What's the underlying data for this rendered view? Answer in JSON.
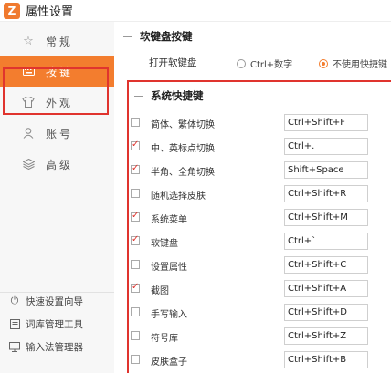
{
  "window": {
    "title": "属性设置",
    "logo_glyph": "Z"
  },
  "sidebar": {
    "items": [
      {
        "label": "常规",
        "icon": "star-icon"
      },
      {
        "label": "按键",
        "icon": "keyboard-icon",
        "active": true
      },
      {
        "label": "外观",
        "icon": "shirt-icon"
      },
      {
        "label": "账号",
        "icon": "user-icon"
      },
      {
        "label": "高级",
        "icon": "layers-icon"
      }
    ],
    "tools": [
      {
        "label": "快速设置向导",
        "icon": "power-icon"
      },
      {
        "label": "词库管理工具",
        "icon": "dictionary-icon"
      },
      {
        "label": "输入法管理器",
        "icon": "monitor-icon"
      }
    ]
  },
  "soft_keyboard": {
    "section_title": "软键盘按键",
    "open_label": "打开软键盘",
    "options": [
      {
        "label": "Ctrl+数字",
        "selected": false
      },
      {
        "label": "不使用快捷键",
        "selected": true
      }
    ]
  },
  "system_shortcuts": {
    "section_title": "系统快捷键",
    "rows": [
      {
        "label": "简体、繁体切换",
        "checked": false,
        "value": "Ctrl+Shift+F"
      },
      {
        "label": "中、英标点切换",
        "checked": true,
        "value": "Ctrl+."
      },
      {
        "label": "半角、全角切换",
        "checked": true,
        "value": "Shift+Space"
      },
      {
        "label": "随机选择皮肤",
        "checked": false,
        "value": "Ctrl+Shift+R"
      },
      {
        "label": "系统菜单",
        "checked": true,
        "value": "Ctrl+Shift+M"
      },
      {
        "label": "软键盘",
        "checked": true,
        "value": "Ctrl+`"
      },
      {
        "label": "设置属性",
        "checked": false,
        "value": "Ctrl+Shift+C"
      },
      {
        "label": "截图",
        "checked": true,
        "value": "Ctrl+Shift+A"
      },
      {
        "label": "手写输入",
        "checked": false,
        "value": "Ctrl+Shift+D"
      },
      {
        "label": "符号库",
        "checked": false,
        "value": "Ctrl+Shift+Z"
      },
      {
        "label": "皮肤盒子",
        "checked": false,
        "value": "Ctrl+Shift+B"
      }
    ]
  },
  "colors": {
    "accent": "#f37d2e",
    "annotation_red": "#e0342e"
  }
}
